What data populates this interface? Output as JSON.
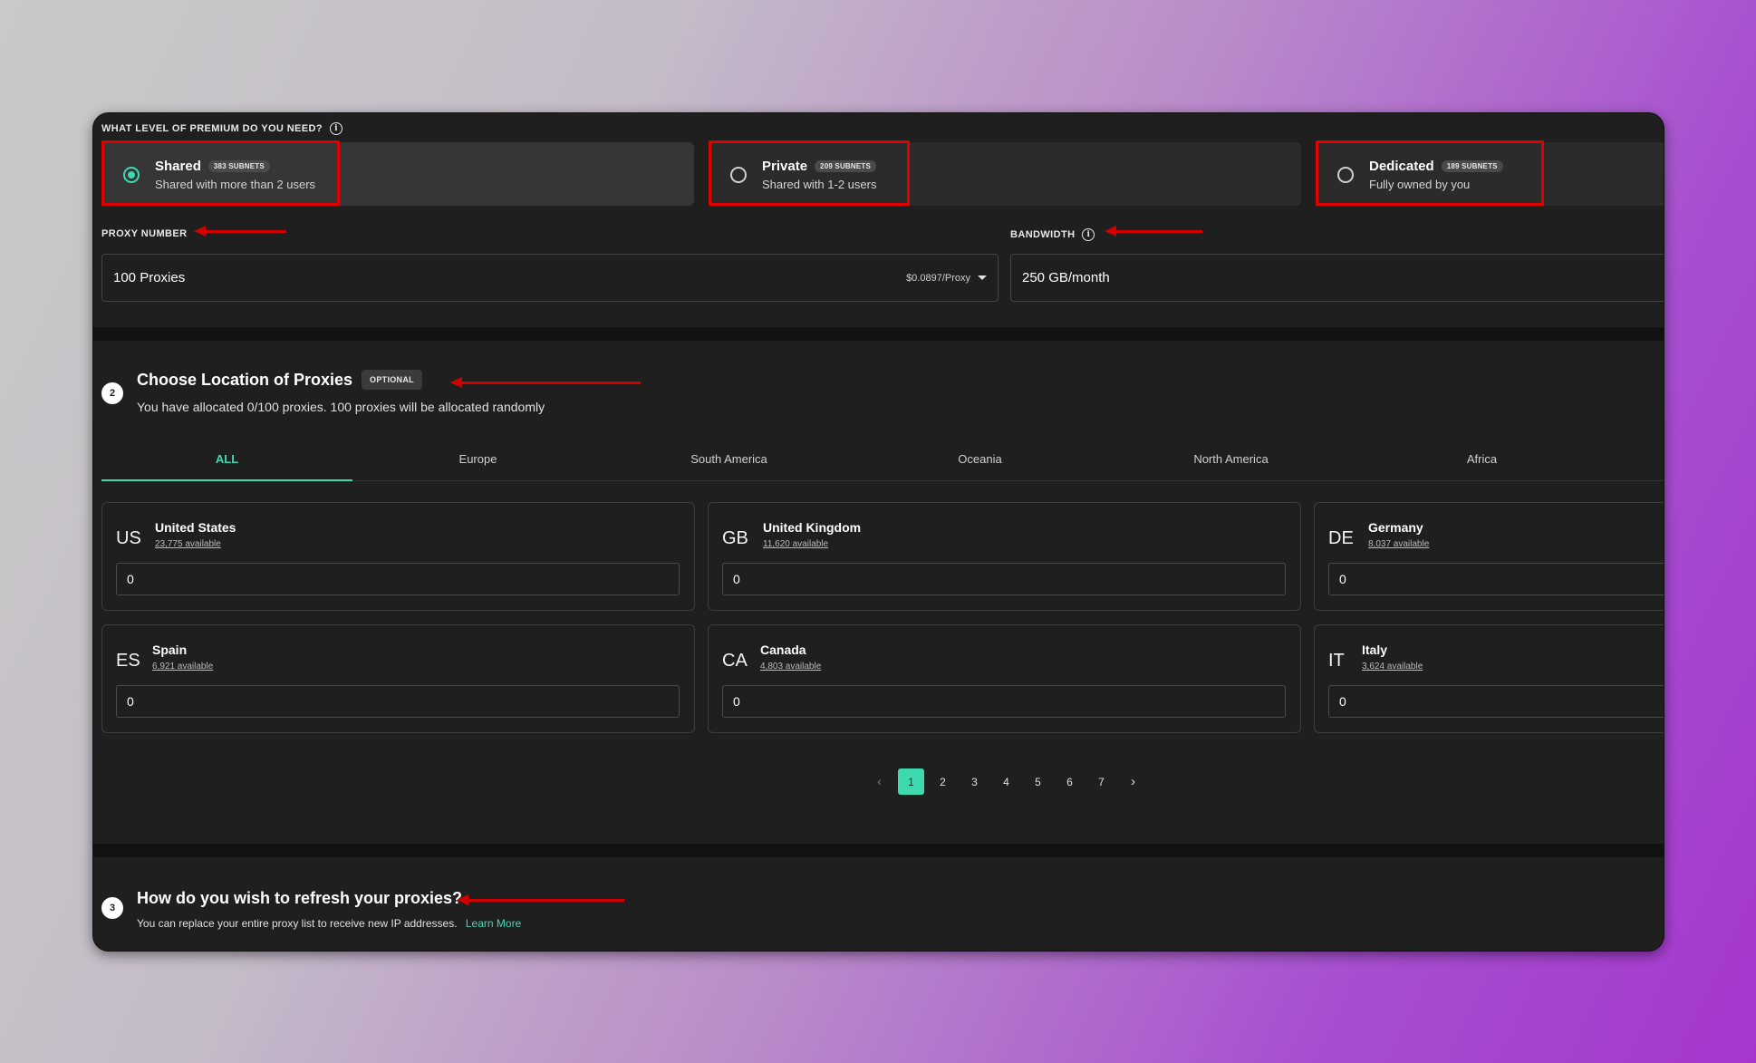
{
  "premium": {
    "question": "WHAT LEVEL OF PREMIUM DO YOU NEED?",
    "tiers": [
      {
        "title": "Shared",
        "badge": "383 SUBNETS",
        "subtitle": "Shared with more than 2 users",
        "selected": true
      },
      {
        "title": "Private",
        "badge": "209 SUBNETS",
        "subtitle": "Shared with 1-2 users",
        "selected": false
      },
      {
        "title": "Dedicated",
        "badge": "189 SUBNETS",
        "subtitle": "Fully owned by you",
        "selected": false
      }
    ]
  },
  "proxy_number": {
    "label": "PROXY NUMBER",
    "value": "100 Proxies",
    "price": "$0.0897/Proxy"
  },
  "bandwidth": {
    "label": "BANDWIDTH",
    "value": "250 GB/month"
  },
  "location": {
    "step": "2",
    "title": "Choose Location of Proxies",
    "badge": "OPTIONAL",
    "subtitle": "You have allocated 0/100 proxies. 100 proxies will be allocated randomly",
    "tabs": [
      "ALL",
      "Europe",
      "South America",
      "Oceania",
      "North America",
      "Africa"
    ],
    "active_tab": "ALL",
    "countries": [
      {
        "code": "US",
        "name": "United States",
        "available": "23,775 available",
        "value": "0"
      },
      {
        "code": "GB",
        "name": "United Kingdom",
        "available": "11,620 available",
        "value": "0"
      },
      {
        "code": "DE",
        "name": "Germany",
        "available": "8,037 available",
        "value": "0"
      },
      {
        "code": "ES",
        "name": "Spain",
        "available": "6,921 available",
        "value": "0"
      },
      {
        "code": "CA",
        "name": "Canada",
        "available": "4,803 available",
        "value": "0"
      },
      {
        "code": "IT",
        "name": "Italy",
        "available": "3,624 available",
        "value": "0"
      }
    ],
    "pagination": {
      "prev": "‹",
      "pages": [
        "1",
        "2",
        "3",
        "4",
        "5",
        "6",
        "7"
      ],
      "active_page": "1",
      "next": "›"
    }
  },
  "refresh": {
    "step": "3",
    "title": "How do you wish to refresh your proxies?",
    "subtitle": "You can replace your entire proxy list to receive new IP addresses.",
    "link": "Learn More"
  },
  "annotations": {
    "highlight_color": "#e10000",
    "arrow_color": "#d00000"
  },
  "colors": {
    "accent": "#3fd9b0",
    "panel": "#1f1f1f"
  }
}
